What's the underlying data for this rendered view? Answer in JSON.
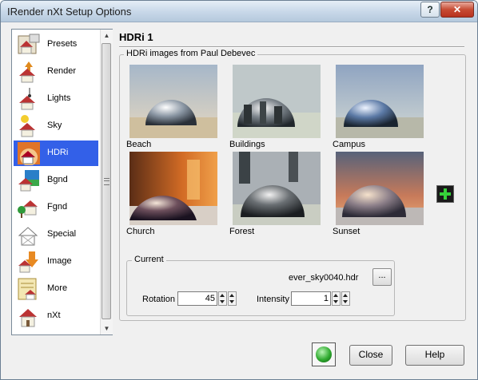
{
  "window": {
    "title": "IRender nXt Setup Options",
    "help": "?",
    "close": "✕"
  },
  "sidebar": {
    "items": [
      {
        "label": "Presets",
        "icon": "presets-house-icon",
        "selected": false
      },
      {
        "label": "Render",
        "icon": "render-house-icon",
        "selected": false
      },
      {
        "label": "Lights",
        "icon": "lights-house-icon",
        "selected": false
      },
      {
        "label": "Sky",
        "icon": "sky-house-icon",
        "selected": false
      },
      {
        "label": "HDRi",
        "icon": "hdri-house-icon",
        "selected": true
      },
      {
        "label": "Bgnd",
        "icon": "background-house-icon",
        "selected": false
      },
      {
        "label": "Fgnd",
        "icon": "foreground-house-icon",
        "selected": false
      },
      {
        "label": "Special",
        "icon": "special-house-icon",
        "selected": false
      },
      {
        "label": "Image",
        "icon": "image-house-icon",
        "selected": false
      },
      {
        "label": "More",
        "icon": "more-house-icon",
        "selected": false
      },
      {
        "label": "nXt",
        "icon": "nxt-house-icon",
        "selected": false
      }
    ]
  },
  "page": {
    "title": "HDRi 1",
    "group_title": "HDRi images from Paul Debevec"
  },
  "hdri_images": [
    {
      "label": "Beach"
    },
    {
      "label": "Buildings"
    },
    {
      "label": "Campus"
    },
    {
      "label": "Church"
    },
    {
      "label": "Forest"
    },
    {
      "label": "Sunset"
    }
  ],
  "add_button_icon": "plus-icon",
  "current": {
    "title": "Current",
    "filename": "ever_sky0040.hdr",
    "browse_label": "...",
    "rotation_label": "Rotation",
    "rotation_value": "45",
    "intensity_label": "Intensity",
    "intensity_value": "1"
  },
  "footer": {
    "close_label": "Close",
    "help_label": "Help",
    "go_icon": "green-orb-icon"
  },
  "colors": {
    "selection": "#3360e8",
    "accent_green": "#36d13a"
  }
}
